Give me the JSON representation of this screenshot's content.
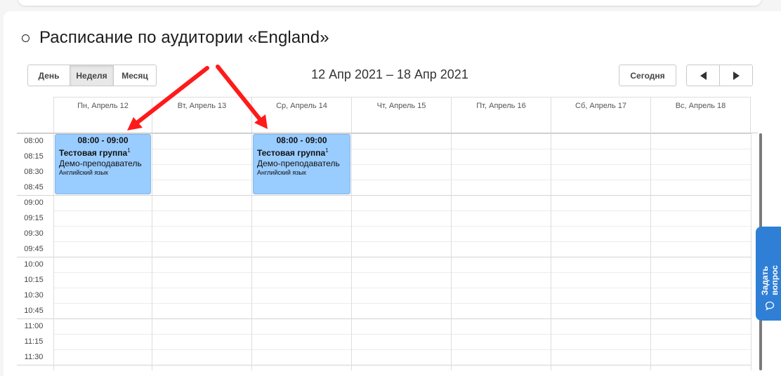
{
  "page": {
    "heading": "Расписание по аудитории «England»"
  },
  "toolbar": {
    "views": [
      {
        "label": "День",
        "active": false
      },
      {
        "label": "Неделя",
        "active": true
      },
      {
        "label": "Месяц",
        "active": false
      }
    ],
    "date_range": "12 Апр 2021 – 18 Апр 2021",
    "today_label": "Сегодня",
    "prev_icon": "triangle-left-icon",
    "next_icon": "triangle-right-icon"
  },
  "calendar": {
    "days": [
      "Пн, Апрель 12",
      "Вт, Апрель 13",
      "Ср, Апрель 14",
      "Чт, Апрель 15",
      "Пт, Апрель 16",
      "Сб, Апрель 17",
      "Вс, Апрель 18"
    ],
    "times": [
      "08:00",
      "08:15",
      "08:30",
      "08:45",
      "09:00",
      "09:15",
      "09:30",
      "09:45",
      "10:00",
      "10:15",
      "10:30",
      "10:45",
      "11:00",
      "11:15",
      "11:30"
    ],
    "events": [
      {
        "day": "Пн, Апрель 12",
        "time": "08:00 - 09:00",
        "group": "Тестовая группа",
        "group_sup": "1",
        "teacher": "Демо-преподаватель",
        "subject": "Английский язык"
      },
      {
        "day": "Ср, Апрель 14",
        "time": "08:00 - 09:00",
        "group": "Тестовая группа",
        "group_sup": "1",
        "teacher": "Демо-преподаватель",
        "subject": "Английский язык"
      }
    ],
    "event_color": "#99ccff"
  },
  "feedback": {
    "label": "Задать вопрос",
    "icon": "chat-bubble-icon",
    "color": "#2f7fd6"
  },
  "annotation_color": "#ff1a1a"
}
